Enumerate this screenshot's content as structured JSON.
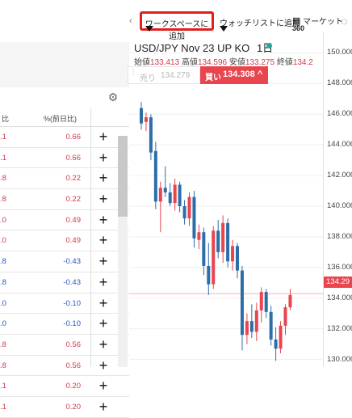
{
  "watchlist": {
    "col_change": "比",
    "col_pct": "%(前日比)",
    "rows": [
      {
        "chg": ".1",
        "pct": "0.66",
        "dir": "up"
      },
      {
        "chg": ".1",
        "pct": "0.66",
        "dir": "up"
      },
      {
        "chg": ".8",
        "pct": "0.22",
        "dir": "up"
      },
      {
        "chg": ".8",
        "pct": "0.22",
        "dir": "up"
      },
      {
        "chg": ".0",
        "pct": "0.49",
        "dir": "up"
      },
      {
        "chg": ".0",
        "pct": "0.49",
        "dir": "up"
      },
      {
        "chg": ".8",
        "pct": "-0.43",
        "dir": "down"
      },
      {
        "chg": ".8",
        "pct": "-0.43",
        "dir": "down"
      },
      {
        "chg": ".0",
        "pct": "-0.10",
        "dir": "down"
      },
      {
        "chg": ".0",
        "pct": "-0.10",
        "dir": "down"
      },
      {
        "chg": ".8",
        "pct": "0.56",
        "dir": "up"
      },
      {
        "chg": ".8",
        "pct": "0.56",
        "dir": "up"
      },
      {
        "chg": ".1",
        "pct": "0.20",
        "dir": "up"
      },
      {
        "chg": ".1",
        "pct": "0.20",
        "dir": "up"
      }
    ],
    "add_symbol": "+"
  },
  "toolbar": {
    "back_glyph": "‹",
    "add_workspace": "ワークスペースに追加",
    "add_watchlist": "ウォッチリストに追加",
    "market_icon": "grid-icon",
    "market_label": "マーケット",
    "market_sub": "360"
  },
  "chart_header": {
    "symbol": "USD/JPY Nov 23 UP KO",
    "interval": "1日",
    "open_label": "始値",
    "open": "133.413",
    "high_label": "高値",
    "high": "134.596",
    "low_label": "安値",
    "low": "133.275",
    "close_label": "終値",
    "close": "134.2",
    "sell_label": "売り",
    "sell_price": "134.279",
    "buy_label": "買い",
    "buy_price": "134.308",
    "current_price": "134.29"
  },
  "chart_data": {
    "type": "candlestick",
    "y_axis_ticks": [
      "150.000",
      "148.000",
      "146.000",
      "144.000",
      "142.000",
      "140.000",
      "138.000",
      "136.000",
      "134.000",
      "132.000",
      "130.000"
    ],
    "ylim": [
      129.5,
      150.5
    ],
    "candles": [
      {
        "o": 146.4,
        "h": 146.8,
        "l": 145.0,
        "c": 145.4
      },
      {
        "o": 145.5,
        "h": 146.1,
        "l": 144.9,
        "c": 145.8
      },
      {
        "o": 145.8,
        "h": 146.0,
        "l": 143.0,
        "c": 143.5
      },
      {
        "o": 143.6,
        "h": 144.2,
        "l": 139.8,
        "c": 140.3
      },
      {
        "o": 140.3,
        "h": 141.6,
        "l": 138.3,
        "c": 141.2
      },
      {
        "o": 141.2,
        "h": 142.6,
        "l": 140.6,
        "c": 140.9
      },
      {
        "o": 140.9,
        "h": 141.5,
        "l": 140.0,
        "c": 140.2
      },
      {
        "o": 140.2,
        "h": 141.8,
        "l": 139.7,
        "c": 141.4
      },
      {
        "o": 141.4,
        "h": 141.6,
        "l": 139.6,
        "c": 140.0
      },
      {
        "o": 140.0,
        "h": 140.4,
        "l": 138.8,
        "c": 139.2
      },
      {
        "o": 139.2,
        "h": 140.9,
        "l": 138.7,
        "c": 140.6
      },
      {
        "o": 140.6,
        "h": 141.0,
        "l": 137.3,
        "c": 137.9
      },
      {
        "o": 137.8,
        "h": 138.8,
        "l": 137.2,
        "c": 138.3
      },
      {
        "o": 138.3,
        "h": 138.6,
        "l": 135.5,
        "c": 136.1
      },
      {
        "o": 136.1,
        "h": 137.6,
        "l": 134.2,
        "c": 134.9
      },
      {
        "o": 134.9,
        "h": 138.7,
        "l": 134.6,
        "c": 138.4
      },
      {
        "o": 138.4,
        "h": 139.1,
        "l": 136.6,
        "c": 137.0
      },
      {
        "o": 137.0,
        "h": 139.4,
        "l": 136.3,
        "c": 138.9
      },
      {
        "o": 138.9,
        "h": 139.2,
        "l": 136.0,
        "c": 136.4
      },
      {
        "o": 136.4,
        "h": 137.8,
        "l": 135.8,
        "c": 137.4
      },
      {
        "o": 137.4,
        "h": 137.6,
        "l": 135.3,
        "c": 135.8
      },
      {
        "o": 135.8,
        "h": 136.1,
        "l": 130.6,
        "c": 131.6
      },
      {
        "o": 131.6,
        "h": 133.0,
        "l": 131.0,
        "c": 132.5
      },
      {
        "o": 132.5,
        "h": 133.6,
        "l": 131.4,
        "c": 131.8
      },
      {
        "o": 131.8,
        "h": 133.7,
        "l": 131.2,
        "c": 133.2
      },
      {
        "o": 133.2,
        "h": 134.7,
        "l": 132.4,
        "c": 134.4
      },
      {
        "o": 134.4,
        "h": 134.6,
        "l": 132.7,
        "c": 133.1
      },
      {
        "o": 133.1,
        "h": 133.5,
        "l": 130.9,
        "c": 131.3
      },
      {
        "o": 131.3,
        "h": 132.1,
        "l": 129.9,
        "c": 130.7
      },
      {
        "o": 130.7,
        "h": 132.5,
        "l": 130.4,
        "c": 132.2
      },
      {
        "o": 132.2,
        "h": 133.6,
        "l": 131.6,
        "c": 133.4
      },
      {
        "o": 133.4,
        "h": 134.6,
        "l": 133.2,
        "c": 134.2
      }
    ],
    "up_color": "#e8454f",
    "down_color": "#2d6ea8"
  }
}
